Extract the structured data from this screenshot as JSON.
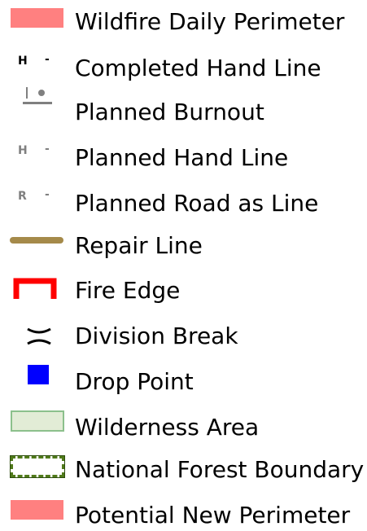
{
  "legend": {
    "items": [
      {
        "label": "Wildfire Daily Perimeter",
        "icon": "pink-filled-rectangle",
        "color": "#ff8080"
      },
      {
        "label": "Completed Hand Line",
        "icon": "hand-line-completed-marker",
        "glyph": "H",
        "dash": "-",
        "color": "#000000"
      },
      {
        "label": "Planned Burnout",
        "icon": "burnout-line-marker",
        "color": "#808080"
      },
      {
        "label": "Planned Hand Line",
        "icon": "hand-line-planned-marker",
        "glyph": "H",
        "dash": "-",
        "color": "#808080"
      },
      {
        "label": "Planned Road as Line",
        "icon": "road-line-planned-marker",
        "glyph": "R",
        "dash": "-",
        "color": "#808080"
      },
      {
        "label": "Repair Line",
        "icon": "repair-line-stroke",
        "color": "#a58a4a"
      },
      {
        "label": "Fire Edge",
        "icon": "fire-edge-bracket",
        "color": "#ff0000"
      },
      {
        "label": "Division Break",
        "icon": "division-break-marker",
        "glyph": ")(",
        "color": "#000000"
      },
      {
        "label": "Drop Point",
        "icon": "blue-square",
        "color": "#0000ff"
      },
      {
        "label": "Wilderness Area",
        "icon": "green-outlined-rectangle",
        "color": "#8cc08c",
        "fill": "#e2ecd6"
      },
      {
        "label": "National Forest Boundary",
        "icon": "dashed-green-rectangle",
        "color": "#507a1a",
        "fill": "#ffffff"
      },
      {
        "label": "Potential New Perimeter",
        "icon": "pink-filled-rectangle",
        "color": "#ff8080"
      }
    ]
  }
}
